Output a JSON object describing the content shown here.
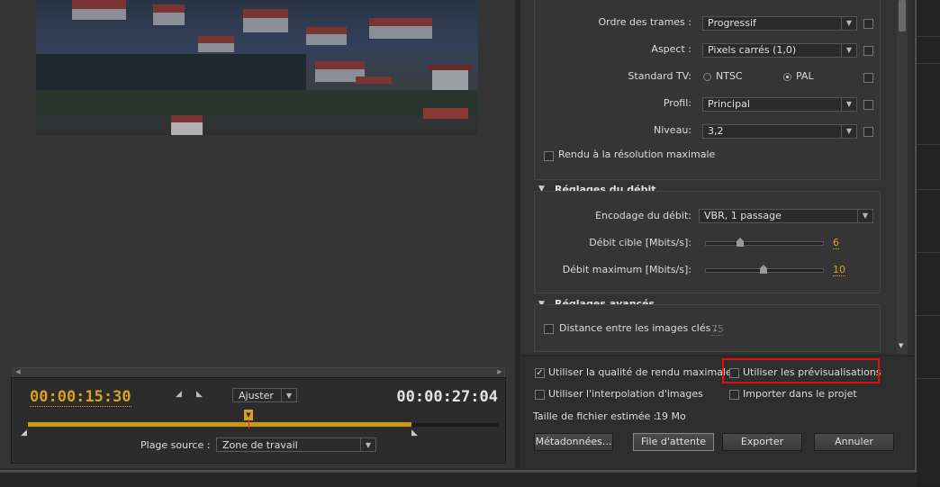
{
  "preview": {
    "timecode_in": "00:00:15:30",
    "timecode_duration": "00:00:27:04",
    "fit_label": "Ajuster",
    "source_range_label": "Plage source :",
    "source_range_value": "Zone de travail",
    "playhead_position": 0.49
  },
  "video_settings": {
    "field_order": {
      "label": "Ordre des trames :",
      "value": "Progressif"
    },
    "aspect": {
      "label": "Aspect :",
      "value": "Pixels carrés (1,0)"
    },
    "tv_standard": {
      "label": "Standard TV:",
      "options": [
        "NTSC",
        "PAL"
      ],
      "selected": "PAL"
    },
    "profile": {
      "label": "Profil:",
      "value": "Principal"
    },
    "level": {
      "label": "Niveau:",
      "value": "3,2"
    },
    "max_render": {
      "label": "Rendu à la résolution maximale",
      "checked": false
    }
  },
  "bitrate": {
    "header": "Réglages du débit",
    "encoding": {
      "label": "Encodage du débit:",
      "value": "VBR, 1 passage"
    },
    "target": {
      "label": "Débit cible [Mbits/s]:",
      "value": "6"
    },
    "maximum": {
      "label": "Débit maximum [Mbits/s]:",
      "value": "10"
    }
  },
  "advanced": {
    "header": "Réglages avancés",
    "keyframe": {
      "label": "Distance entre les images clés :",
      "value": "75",
      "checked": false
    }
  },
  "options": {
    "max_quality": {
      "label": "Utiliser la qualité de rendu maximale",
      "checked": true
    },
    "use_previews": {
      "label": "Utiliser les prévisualisations",
      "checked": false
    },
    "interpolation": {
      "label": "Utiliser l'interpolation d'images",
      "checked": false
    },
    "import_project": {
      "label": "Importer dans le projet",
      "checked": false
    },
    "file_size_label": "Taille de fichier estimée :",
    "file_size_value": "19 Mo"
  },
  "buttons": {
    "metadata": "Métadonnées...",
    "queue": "File d'attente",
    "export": "Exporter",
    "cancel": "Annuler"
  },
  "icons": {
    "dropdown": "▼",
    "expand": "▼",
    "scroll_up": "▲",
    "scroll_down": "▼",
    "scroll_left": "◀",
    "scroll_right": "▶",
    "check": "✓"
  },
  "colors": {
    "accent": "#d9a11e",
    "highlight": "#e01010"
  }
}
